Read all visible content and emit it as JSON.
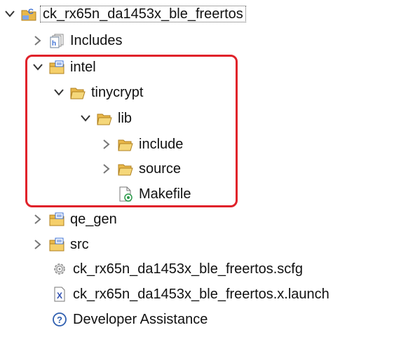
{
  "tree": {
    "project": {
      "label": "ck_rx65n_da1453x_ble_freertos",
      "icon": "c-project-icon",
      "expanded": true
    },
    "items": [
      {
        "label": "Includes",
        "icon": "includes-icon",
        "state": "collapsed"
      },
      {
        "label": "intel",
        "icon": "source-folder-icon",
        "state": "expanded"
      },
      {
        "label": "tinycrypt",
        "icon": "folder-open-icon",
        "state": "expanded"
      },
      {
        "label": "lib",
        "icon": "folder-open-icon",
        "state": "expanded"
      },
      {
        "label": "include",
        "icon": "folder-icon",
        "state": "collapsed"
      },
      {
        "label": "source",
        "icon": "folder-icon",
        "state": "collapsed"
      },
      {
        "label": "Makefile",
        "icon": "makefile-icon",
        "state": "leaf"
      },
      {
        "label": "qe_gen",
        "icon": "source-folder-icon",
        "state": "collapsed"
      },
      {
        "label": "src",
        "icon": "source-folder-icon",
        "state": "collapsed"
      },
      {
        "label": "ck_rx65n_da1453x_ble_freertos.scfg",
        "icon": "gear-config-icon",
        "state": "leaf"
      },
      {
        "label": "ck_rx65n_da1453x_ble_freertos.x.launch",
        "icon": "launch-file-icon",
        "state": "leaf"
      },
      {
        "label": "Developer Assistance",
        "icon": "help-icon",
        "state": "leaf"
      }
    ]
  },
  "colors": {
    "highlight": "#e0222a",
    "folder": "#e9b84a",
    "source_folder_badge": "#3a6fd6"
  }
}
